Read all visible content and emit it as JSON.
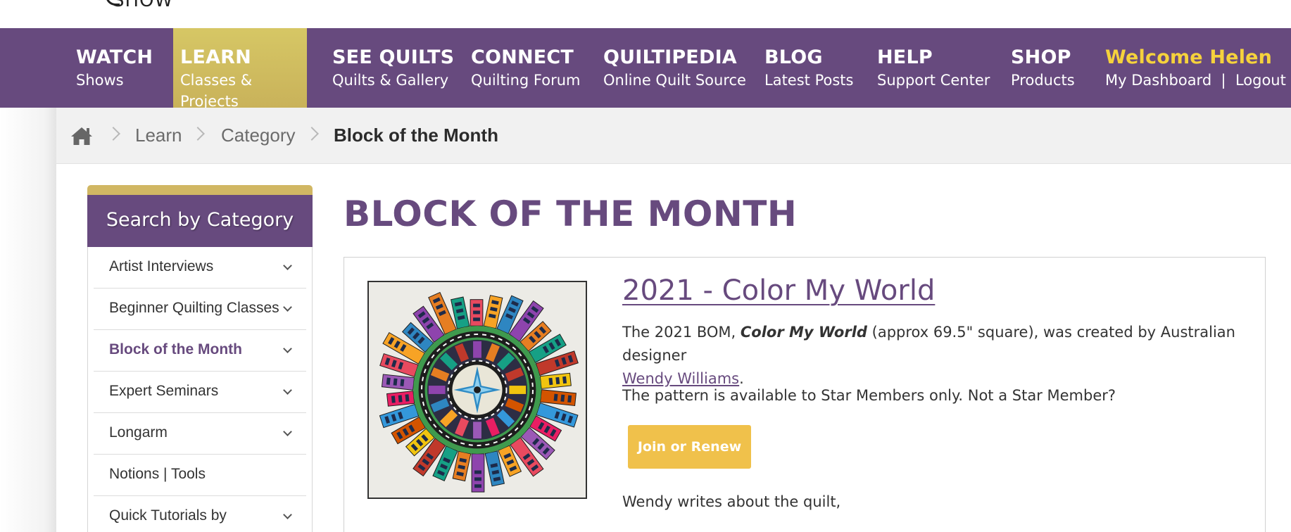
{
  "logo": {
    "text": "SHOW"
  },
  "nav": {
    "items": [
      {
        "title": "WATCH",
        "sub": "Shows"
      },
      {
        "title": "LEARN",
        "sub": "Classes & Projects"
      },
      {
        "title": "SEE QUILTS",
        "sub": "Quilts & Gallery"
      },
      {
        "title": "CONNECT",
        "sub": "Quilting Forum"
      },
      {
        "title": "QUILTIPEDIA",
        "sub": "Online Quilt Source"
      },
      {
        "title": "BLOG",
        "sub": "Latest Posts"
      },
      {
        "title": "HELP",
        "sub": "Support Center"
      },
      {
        "title": "SHOP",
        "sub": "Products"
      }
    ],
    "welcome": {
      "title": "Welcome Helen",
      "dashboard": "My Dashboard",
      "separator": "|",
      "logout": "Logout"
    },
    "active_color": "#d4c262",
    "bar_color": "#674a7e"
  },
  "breadcrumb": {
    "home_icon": "home-icon",
    "items": [
      "Learn",
      "Category"
    ],
    "current": "Block of the Month"
  },
  "sidebar": {
    "title": "Search by Category",
    "items": [
      {
        "label": "Artist Interviews",
        "chevron": true
      },
      {
        "label": "Beginner Quilting Classes",
        "chevron": true
      },
      {
        "label": "Block of the Month",
        "chevron": true,
        "active": true
      },
      {
        "label": "Expert Seminars",
        "chevron": true
      },
      {
        "label": "Longarm",
        "chevron": true
      },
      {
        "label": "Notions | Tools",
        "chevron": false
      },
      {
        "label": "Quick Tutorials by",
        "chevron": true
      }
    ]
  },
  "main": {
    "title": "BLOCK OF THE MONTH",
    "card": {
      "title": "2021 - Color My World",
      "p1_before": "The 2021 BOM, ",
      "p1_em": "Color My World",
      "p1_after": " (approx 69.5\" square), was created by Australian designer",
      "p1_link": "Wendy Williams",
      "p1_end": ".",
      "p2": "The pattern is available to Star Members only.  Not a Star Member?",
      "button": "Join or Renew",
      "p3": "Wendy writes about the quilt,"
    }
  }
}
